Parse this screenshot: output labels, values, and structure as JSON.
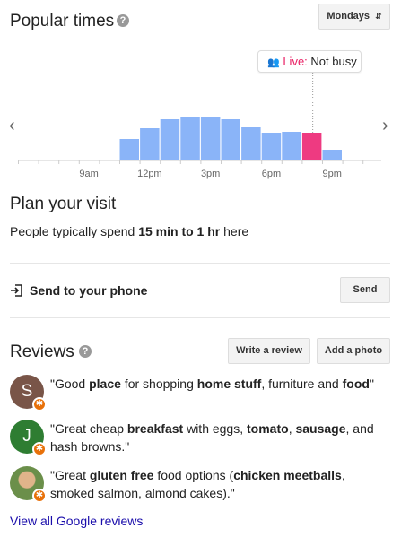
{
  "popular_times": {
    "title": "Popular times",
    "help_icon": "?",
    "day_label": "Mondays",
    "live_label": "Live:",
    "live_status": "Not busy",
    "x_labels": [
      "9am",
      "12pm",
      "3pm",
      "6pm",
      "9pm"
    ],
    "colors": {
      "bar": "#8ab4f8",
      "live_bar": "#ee3a81",
      "live_text": "#e91e63"
    }
  },
  "chart_data": {
    "type": "bar",
    "hours": [
      6,
      7,
      8,
      9,
      10,
      11,
      12,
      13,
      14,
      15,
      16,
      17,
      18,
      19,
      20,
      21,
      22,
      23
    ],
    "values": [
      0,
      0,
      0,
      0,
      0,
      24,
      36,
      46,
      48,
      49,
      46,
      37,
      31,
      32,
      31,
      12,
      0,
      0
    ],
    "live_hour": 20,
    "x_tick_labels": [
      "9am",
      "12pm",
      "3pm",
      "6pm",
      "9pm"
    ]
  },
  "plan": {
    "title": "Plan your visit",
    "text_prefix": "People typically spend ",
    "text_bold": "15 min to 1 hr",
    "text_suffix": " here"
  },
  "send": {
    "label": "Send to your phone",
    "button": "Send",
    "icon": "send-to-phone-icon"
  },
  "reviews": {
    "title": "Reviews",
    "help_icon": "?",
    "write_button": "Write a review",
    "photo_button": "Add a photo",
    "items": [
      {
        "avatar_letter": "S",
        "avatar_color": "#795548",
        "segments": [
          "\"Good ",
          "place",
          " for shopping ",
          "home stuff",
          ", furniture and ",
          "food",
          "\""
        ]
      },
      {
        "avatar_letter": "J",
        "avatar_color": "#2e7d32",
        "segments": [
          "\"Great cheap ",
          "breakfast",
          " with eggs, ",
          "tomato",
          ", ",
          "sausage",
          ", and hash browns.\""
        ]
      },
      {
        "avatar_letter": "",
        "avatar_color": "#7a9a5c",
        "segments": [
          "\"Great ",
          "gluten free",
          " food options (",
          "chicken meetballs",
          ", smoked salmon, almond cakes).\""
        ]
      }
    ],
    "view_all": "View all Google reviews"
  }
}
